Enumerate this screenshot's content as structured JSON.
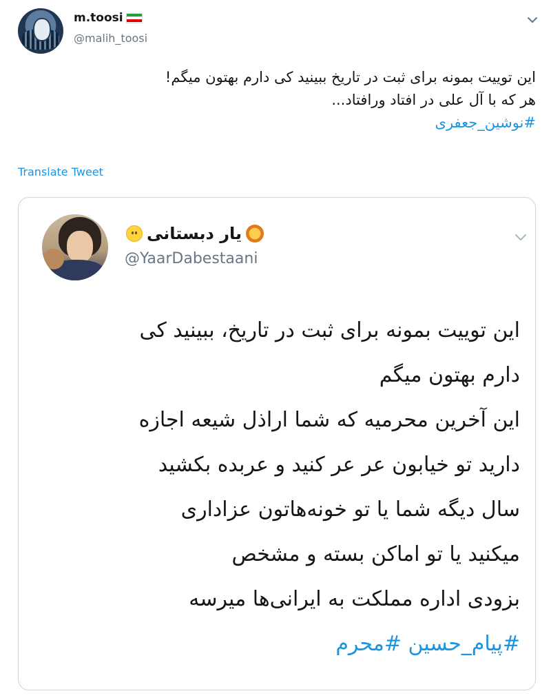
{
  "tweet": {
    "user_name": "m.toosi",
    "handle": "@malih_toosi",
    "text_lines": [
      "این توییت بمونه برای ثبت در تاریخ ببینید کی دارم بهتون میگم!",
      "هر که با آل علی در افتاد ورافتاد..."
    ],
    "hashtag": "#نوشین_جعفری",
    "translate_label": "Translate Tweet"
  },
  "quoted": {
    "user_name": "یار دبستانی",
    "handle": "@YaarDabestaani",
    "text_lines": [
      "این توییت بمونه برای ثبت در تاریخ، ببینید کی",
      "دارم بهتون میگم",
      "این آخرین محرمیه که شما اراذل شیعه اجازه",
      "دارید تو خیابون عر عر کنید و عربده بکشید",
      "سال دیگه شما یا تو خونه‌هاتون عزاداری",
      "میکنید یا تو اماکن بسته و مشخص",
      "بزودی اداره مملکت به ایرانی‌ها میرسه"
    ],
    "hashtags": "#پیام_حسین #محرم"
  },
  "icons": {
    "more": "chevron-down-icon",
    "flag": "iran-flag-icon",
    "emoji_lion": "lion-face-emoji",
    "emoji_face": "smiley-emoji"
  },
  "colors": {
    "link": "#1b95e0",
    "secondary_text": "#657786",
    "border": "#ccd6dd"
  }
}
